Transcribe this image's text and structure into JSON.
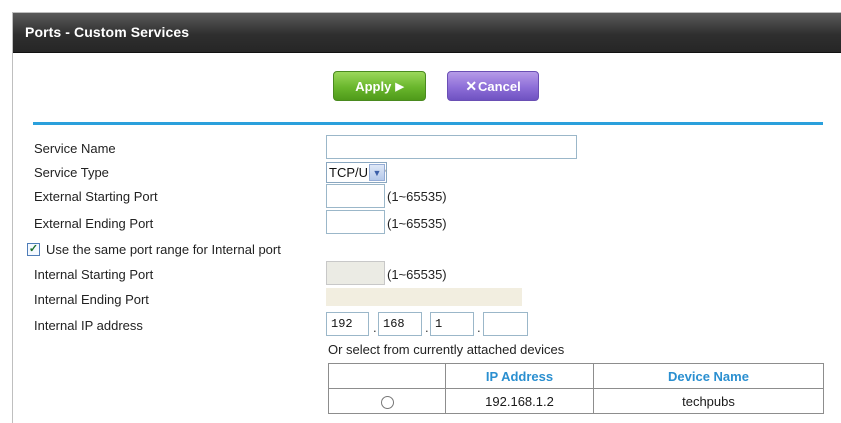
{
  "header": {
    "title": "Ports - Custom Services"
  },
  "buttons": {
    "apply_label": "Apply",
    "apply_glyph": "▶",
    "cancel_glyph": "✕",
    "cancel_label": "Cancel"
  },
  "form": {
    "service_name": {
      "label": "Service Name",
      "value": ""
    },
    "service_type": {
      "label": "Service Type",
      "value": "TCP/UDP"
    },
    "external_start": {
      "label": "External Starting Port",
      "value": "",
      "range": "(1~65535)"
    },
    "external_end": {
      "label": "External Ending Port",
      "value": "",
      "range": "(1~65535)"
    },
    "same_range": {
      "label": "Use the same port range for Internal port",
      "checked": true,
      "check_glyph": "✓"
    },
    "internal_start": {
      "label": "Internal Starting Port",
      "value": "",
      "range": "(1~65535)"
    },
    "internal_end": {
      "label": "Internal Ending Port",
      "value": ""
    },
    "internal_ip": {
      "label": "Internal IP address",
      "octets": [
        "192",
        "168",
        "1",
        ""
      ],
      "separator": "."
    }
  },
  "devices": {
    "prompt": "Or select from currently attached devices",
    "columns": [
      "",
      "IP Address",
      "Device Name"
    ],
    "rows": [
      {
        "ip": "192.168.1.2",
        "name": "techpubs",
        "selected": false
      }
    ]
  },
  "colors": {
    "accent": "#2aa0dc",
    "apply": "#69b62c",
    "cancel": "#8d6ed8",
    "title_bar": "#2f2f2f"
  },
  "icons": {
    "select_arrow": "chevron-down-icon",
    "apply": "play-arrow-icon",
    "cancel": "close-icon"
  }
}
